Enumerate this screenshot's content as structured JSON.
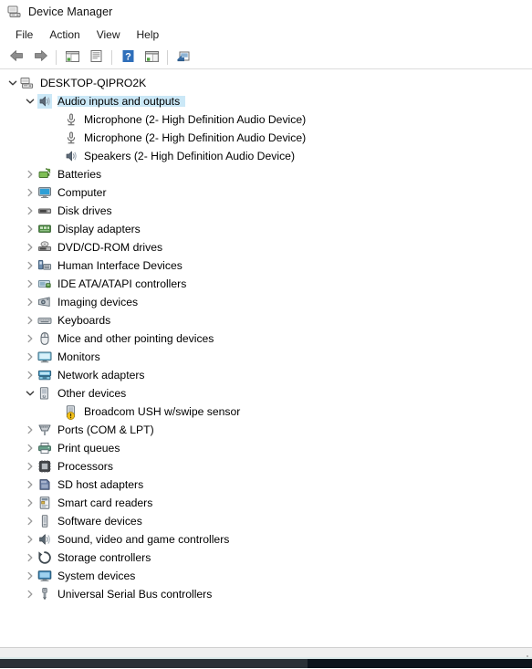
{
  "window": {
    "title": "Device Manager",
    "icon": "device-manager-icon"
  },
  "menubar": {
    "items": [
      {
        "label": "File",
        "name": "menu-file"
      },
      {
        "label": "Action",
        "name": "menu-action"
      },
      {
        "label": "View",
        "name": "menu-view"
      },
      {
        "label": "Help",
        "name": "menu-help"
      }
    ]
  },
  "toolbar": {
    "buttons": [
      {
        "name": "back-button",
        "icon": "back-arrow-icon",
        "tooltip": "Back"
      },
      {
        "name": "forward-button",
        "icon": "forward-arrow-icon",
        "tooltip": "Forward"
      },
      {
        "name": "separator-1",
        "icon": "separator"
      },
      {
        "name": "show-hide-console-tree-button",
        "icon": "console-tree-icon",
        "tooltip": "Show/Hide Console Tree"
      },
      {
        "name": "properties-button",
        "icon": "properties-icon",
        "tooltip": "Properties"
      },
      {
        "name": "separator-2",
        "icon": "separator"
      },
      {
        "name": "help-button",
        "icon": "help-question-icon",
        "tooltip": "Help"
      },
      {
        "name": "scan-for-hardware-changes-button",
        "icon": "scan-hardware-icon",
        "tooltip": "Scan for hardware changes"
      },
      {
        "name": "separator-3",
        "icon": "separator"
      },
      {
        "name": "update-driver-button",
        "icon": "update-driver-icon",
        "tooltip": "Update driver"
      }
    ]
  },
  "tree": {
    "nodes": [
      {
        "label": "DESKTOP-QIPRO2K",
        "level": 0,
        "state": "expanded",
        "icon": "computer-root-icon",
        "selected": false,
        "warning": false
      },
      {
        "label": "Audio inputs and outputs",
        "level": 1,
        "state": "expanded",
        "icon": "speaker-icon",
        "selected": true,
        "warning": false
      },
      {
        "label": "Microphone (2- High Definition Audio Device)",
        "level": 2,
        "state": "leaf",
        "icon": "microphone-icon",
        "selected": false,
        "warning": false
      },
      {
        "label": "Microphone (2- High Definition Audio Device)",
        "level": 2,
        "state": "leaf",
        "icon": "microphone-icon",
        "selected": false,
        "warning": false
      },
      {
        "label": "Speakers (2- High Definition Audio Device)",
        "level": 2,
        "state": "leaf",
        "icon": "speaker-icon",
        "selected": false,
        "warning": false
      },
      {
        "label": "Batteries",
        "level": 1,
        "state": "collapsed",
        "icon": "battery-icon",
        "selected": false,
        "warning": false
      },
      {
        "label": "Computer",
        "level": 1,
        "state": "collapsed",
        "icon": "monitor-icon",
        "selected": false,
        "warning": false
      },
      {
        "label": "Disk drives",
        "level": 1,
        "state": "collapsed",
        "icon": "disk-drive-icon",
        "selected": false,
        "warning": false
      },
      {
        "label": "Display adapters",
        "level": 1,
        "state": "collapsed",
        "icon": "display-adapter-icon",
        "selected": false,
        "warning": false
      },
      {
        "label": "DVD/CD-ROM drives",
        "level": 1,
        "state": "collapsed",
        "icon": "dvd-drive-icon",
        "selected": false,
        "warning": false
      },
      {
        "label": "Human Interface Devices",
        "level": 1,
        "state": "collapsed",
        "icon": "hid-icon",
        "selected": false,
        "warning": false
      },
      {
        "label": "IDE ATA/ATAPI controllers",
        "level": 1,
        "state": "collapsed",
        "icon": "ide-controller-icon",
        "selected": false,
        "warning": false
      },
      {
        "label": "Imaging devices",
        "level": 1,
        "state": "collapsed",
        "icon": "camera-icon",
        "selected": false,
        "warning": false
      },
      {
        "label": "Keyboards",
        "level": 1,
        "state": "collapsed",
        "icon": "keyboard-icon",
        "selected": false,
        "warning": false
      },
      {
        "label": "Mice and other pointing devices",
        "level": 1,
        "state": "collapsed",
        "icon": "mouse-icon",
        "selected": false,
        "warning": false
      },
      {
        "label": "Monitors",
        "level": 1,
        "state": "collapsed",
        "icon": "monitors-icon",
        "selected": false,
        "warning": false
      },
      {
        "label": "Network adapters",
        "level": 1,
        "state": "collapsed",
        "icon": "network-adapter-icon",
        "selected": false,
        "warning": false
      },
      {
        "label": "Other devices",
        "level": 1,
        "state": "expanded",
        "icon": "other-device-icon",
        "selected": false,
        "warning": false
      },
      {
        "label": "Broadcom USH w/swipe sensor",
        "level": 2,
        "state": "leaf",
        "icon": "other-device-icon",
        "selected": false,
        "warning": true
      },
      {
        "label": "Ports (COM & LPT)",
        "level": 1,
        "state": "collapsed",
        "icon": "port-icon",
        "selected": false,
        "warning": false
      },
      {
        "label": "Print queues",
        "level": 1,
        "state": "collapsed",
        "icon": "printer-icon",
        "selected": false,
        "warning": false
      },
      {
        "label": "Processors",
        "level": 1,
        "state": "collapsed",
        "icon": "processor-icon",
        "selected": false,
        "warning": false
      },
      {
        "label": "SD host adapters",
        "level": 1,
        "state": "collapsed",
        "icon": "sd-host-adapter-icon",
        "selected": false,
        "warning": false
      },
      {
        "label": "Smart card readers",
        "level": 1,
        "state": "collapsed",
        "icon": "smart-card-reader-icon",
        "selected": false,
        "warning": false
      },
      {
        "label": "Software devices",
        "level": 1,
        "state": "collapsed",
        "icon": "software-device-icon",
        "selected": false,
        "warning": false
      },
      {
        "label": "Sound, video and game controllers",
        "level": 1,
        "state": "collapsed",
        "icon": "sound-controller-icon",
        "selected": false,
        "warning": false
      },
      {
        "label": "Storage controllers",
        "level": 1,
        "state": "collapsed",
        "icon": "storage-controller-icon",
        "selected": false,
        "warning": false
      },
      {
        "label": "System devices",
        "level": 1,
        "state": "collapsed",
        "icon": "system-device-icon",
        "selected": false,
        "warning": false
      },
      {
        "label": "Universal Serial Bus controllers",
        "level": 1,
        "state": "collapsed",
        "icon": "usb-controller-icon",
        "selected": false,
        "warning": false
      }
    ]
  },
  "statusbar": {
    "text": ""
  },
  "colors": {
    "selection": "#cbe8f7",
    "accent_strip": "#3d7b83",
    "toolbar_help": "#2f6fba",
    "warning_badge": "#f2c018",
    "window_background": "#ffffff",
    "statusbar_background": "#efefef"
  }
}
